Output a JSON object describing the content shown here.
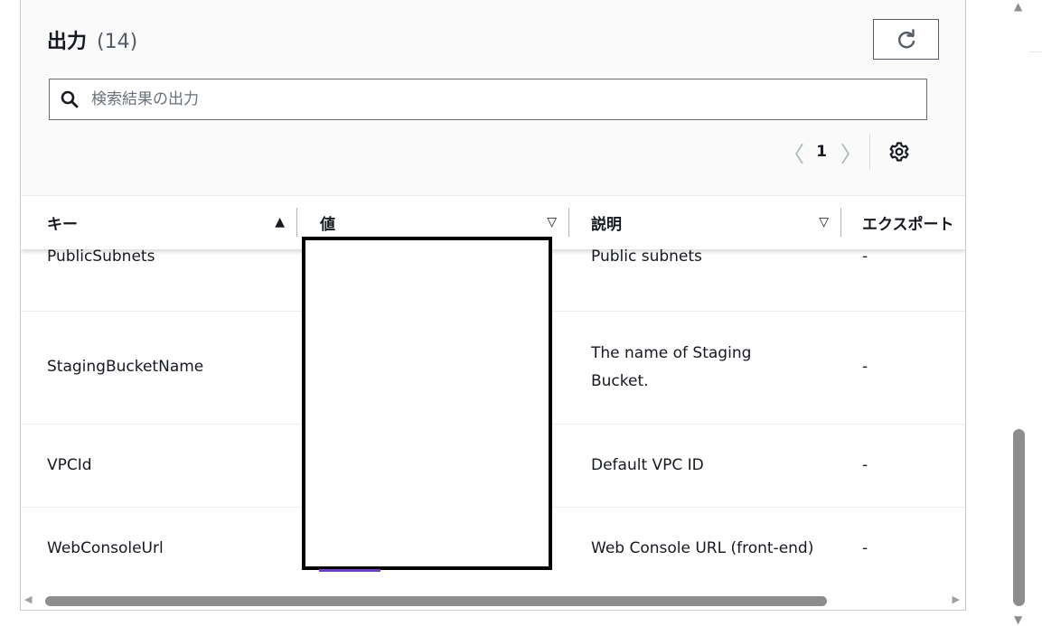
{
  "header": {
    "title": "出力",
    "count": "(14)",
    "search_placeholder": "検索結果の出力"
  },
  "pagination": {
    "prev_glyph": "〈",
    "current_page": "1",
    "next_glyph": "〉"
  },
  "table": {
    "columns": [
      {
        "label": "キー",
        "sort": "▲"
      },
      {
        "label": "値",
        "sort": "▽"
      },
      {
        "label": "説明",
        "sort": "▽"
      },
      {
        "label": "エクスポート"
      }
    ],
    "rows": [
      {
        "key": "PublicSubnets",
        "description": "Public subnets",
        "export": "-"
      },
      {
        "key": "StagingBucketName",
        "description": "The name of Staging Bucket.",
        "export": "-"
      },
      {
        "key": "VPCId",
        "description": "Default VPC ID",
        "export": "-"
      },
      {
        "key": "WebConsoleUrl",
        "description": "Web Console URL (front-end)",
        "export": "-"
      }
    ]
  },
  "colors": {
    "link": "#6b40c2",
    "scrollbar": "#8d8d8d",
    "border": "#545b64"
  },
  "icons": [
    "refresh-icon",
    "search-icon",
    "settings-gear-icon"
  ]
}
